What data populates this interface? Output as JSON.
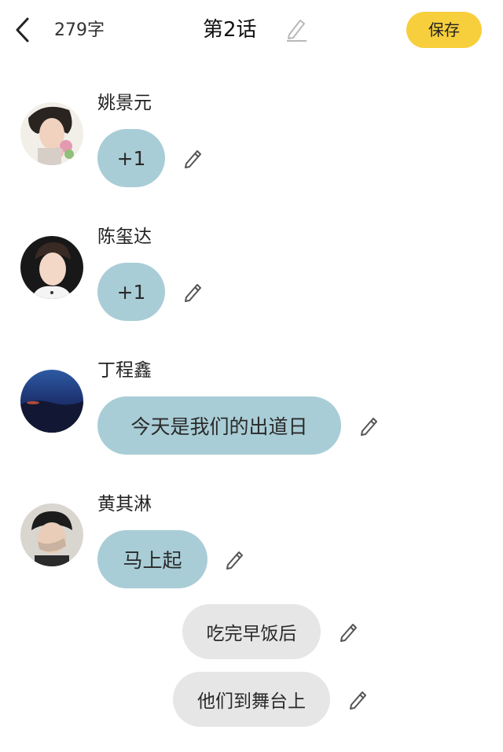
{
  "header": {
    "word_count": "279字",
    "title": "第2话",
    "save_label": "保存"
  },
  "messages": [
    {
      "author": "姚景元",
      "text": "+1"
    },
    {
      "author": "陈玺达",
      "text": "+1"
    },
    {
      "author": "丁程鑫",
      "text": "今天是我们的出道日"
    },
    {
      "author": "黄其淋",
      "text": "马上起"
    }
  ],
  "narration": [
    {
      "text": "吃完早饭后"
    },
    {
      "text": "他们到舞台上"
    }
  ],
  "colors": {
    "accent": "#f7cf3c",
    "character_bubble": "#a9cdd6",
    "narration_bubble": "#e6e6e6"
  }
}
